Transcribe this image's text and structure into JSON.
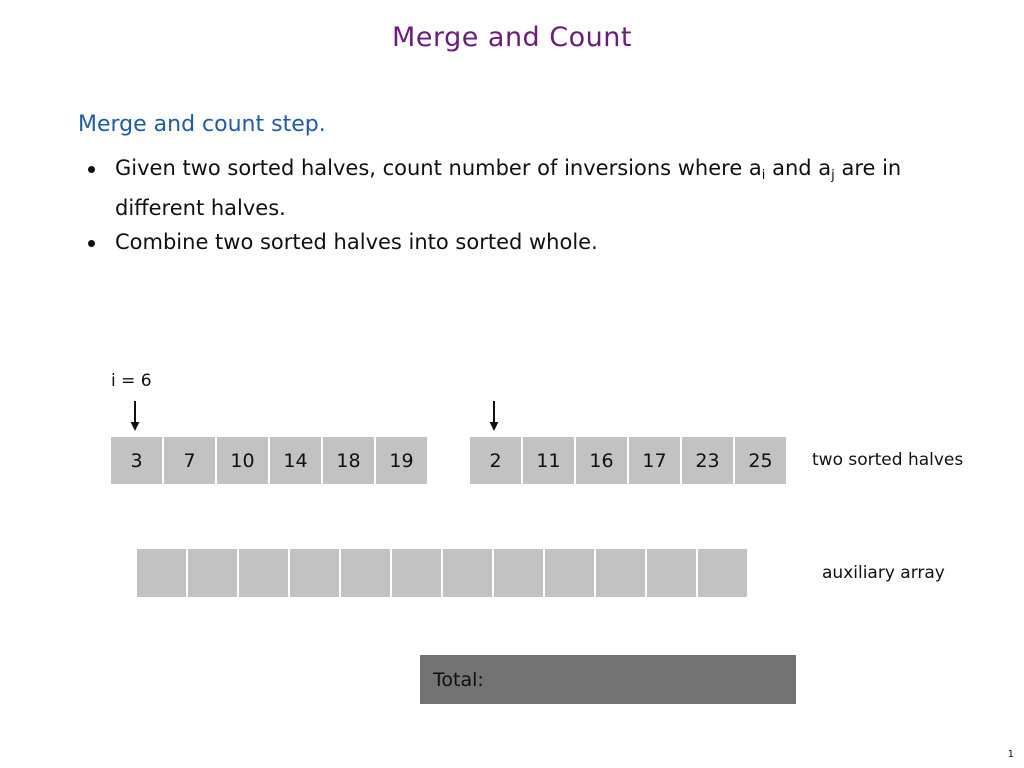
{
  "slide": {
    "title": "Merge and Count",
    "page_number": "1",
    "title_color": "#6b1b7b",
    "subhead_color": "#1f5aa8",
    "cell_fill": "#c2c2c2",
    "total_fill": "#737373"
  },
  "content": {
    "subhead": "Merge and count step.",
    "bullets": [
      {
        "lead": "Given two sorted halves, count number of inversions where a",
        "sub1": "i",
        "mid": " and a",
        "sub2": "j",
        "tail": " are in different halves."
      },
      {
        "lead": "Combine two sorted halves into sorted whole.",
        "sub1": "",
        "mid": "",
        "sub2": "",
        "tail": ""
      }
    ]
  },
  "diagram": {
    "pointer_label": "i = 6",
    "left_array": [
      "3",
      "7",
      "10",
      "14",
      "18",
      "19"
    ],
    "right_array": [
      "2",
      "11",
      "16",
      "17",
      "23",
      "25"
    ],
    "aux_array": [
      "",
      "",
      "",
      "",
      "",
      "",
      "",
      "",
      "",
      "",
      "",
      ""
    ],
    "label_halves": "two sorted halves",
    "label_aux": "auxiliary array",
    "total_label": "Total:"
  }
}
